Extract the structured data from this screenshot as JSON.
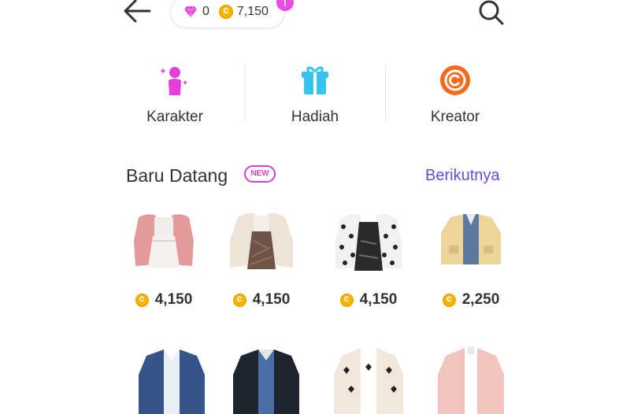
{
  "header": {
    "gem_count": "0",
    "coin_balance": "7,150",
    "alert_mark": "!"
  },
  "categories": [
    {
      "label": "Karakter",
      "icon": "character-icon"
    },
    {
      "label": "Hadiah",
      "icon": "gift-icon"
    },
    {
      "label": "Kreator",
      "icon": "creator-icon"
    }
  ],
  "section": {
    "title": "Baru Datang",
    "badge": "NEW",
    "see_more": "Berikutnya"
  },
  "products": [
    {
      "price": "4,150",
      "item": "pink-jacket-dress"
    },
    {
      "price": "4,150",
      "item": "fur-jacket-dress"
    },
    {
      "price": "4,150",
      "item": "leopard-sleeve-dress"
    },
    {
      "price": "2,250",
      "item": "yellow-jacket"
    },
    {
      "item": "blue-denim-jacket"
    },
    {
      "item": "black-jacket"
    },
    {
      "item": "heart-cardigan"
    },
    {
      "item": "pink-fur-coat"
    }
  ],
  "colors": {
    "accent_purple": "#6a4bd8",
    "badge_pink": "#cc45cf",
    "coin_gold": "#f7b500",
    "gift_blue": "#36c3ee",
    "creator_orange": "#f26a1b",
    "character_pink": "#e43fd9"
  }
}
